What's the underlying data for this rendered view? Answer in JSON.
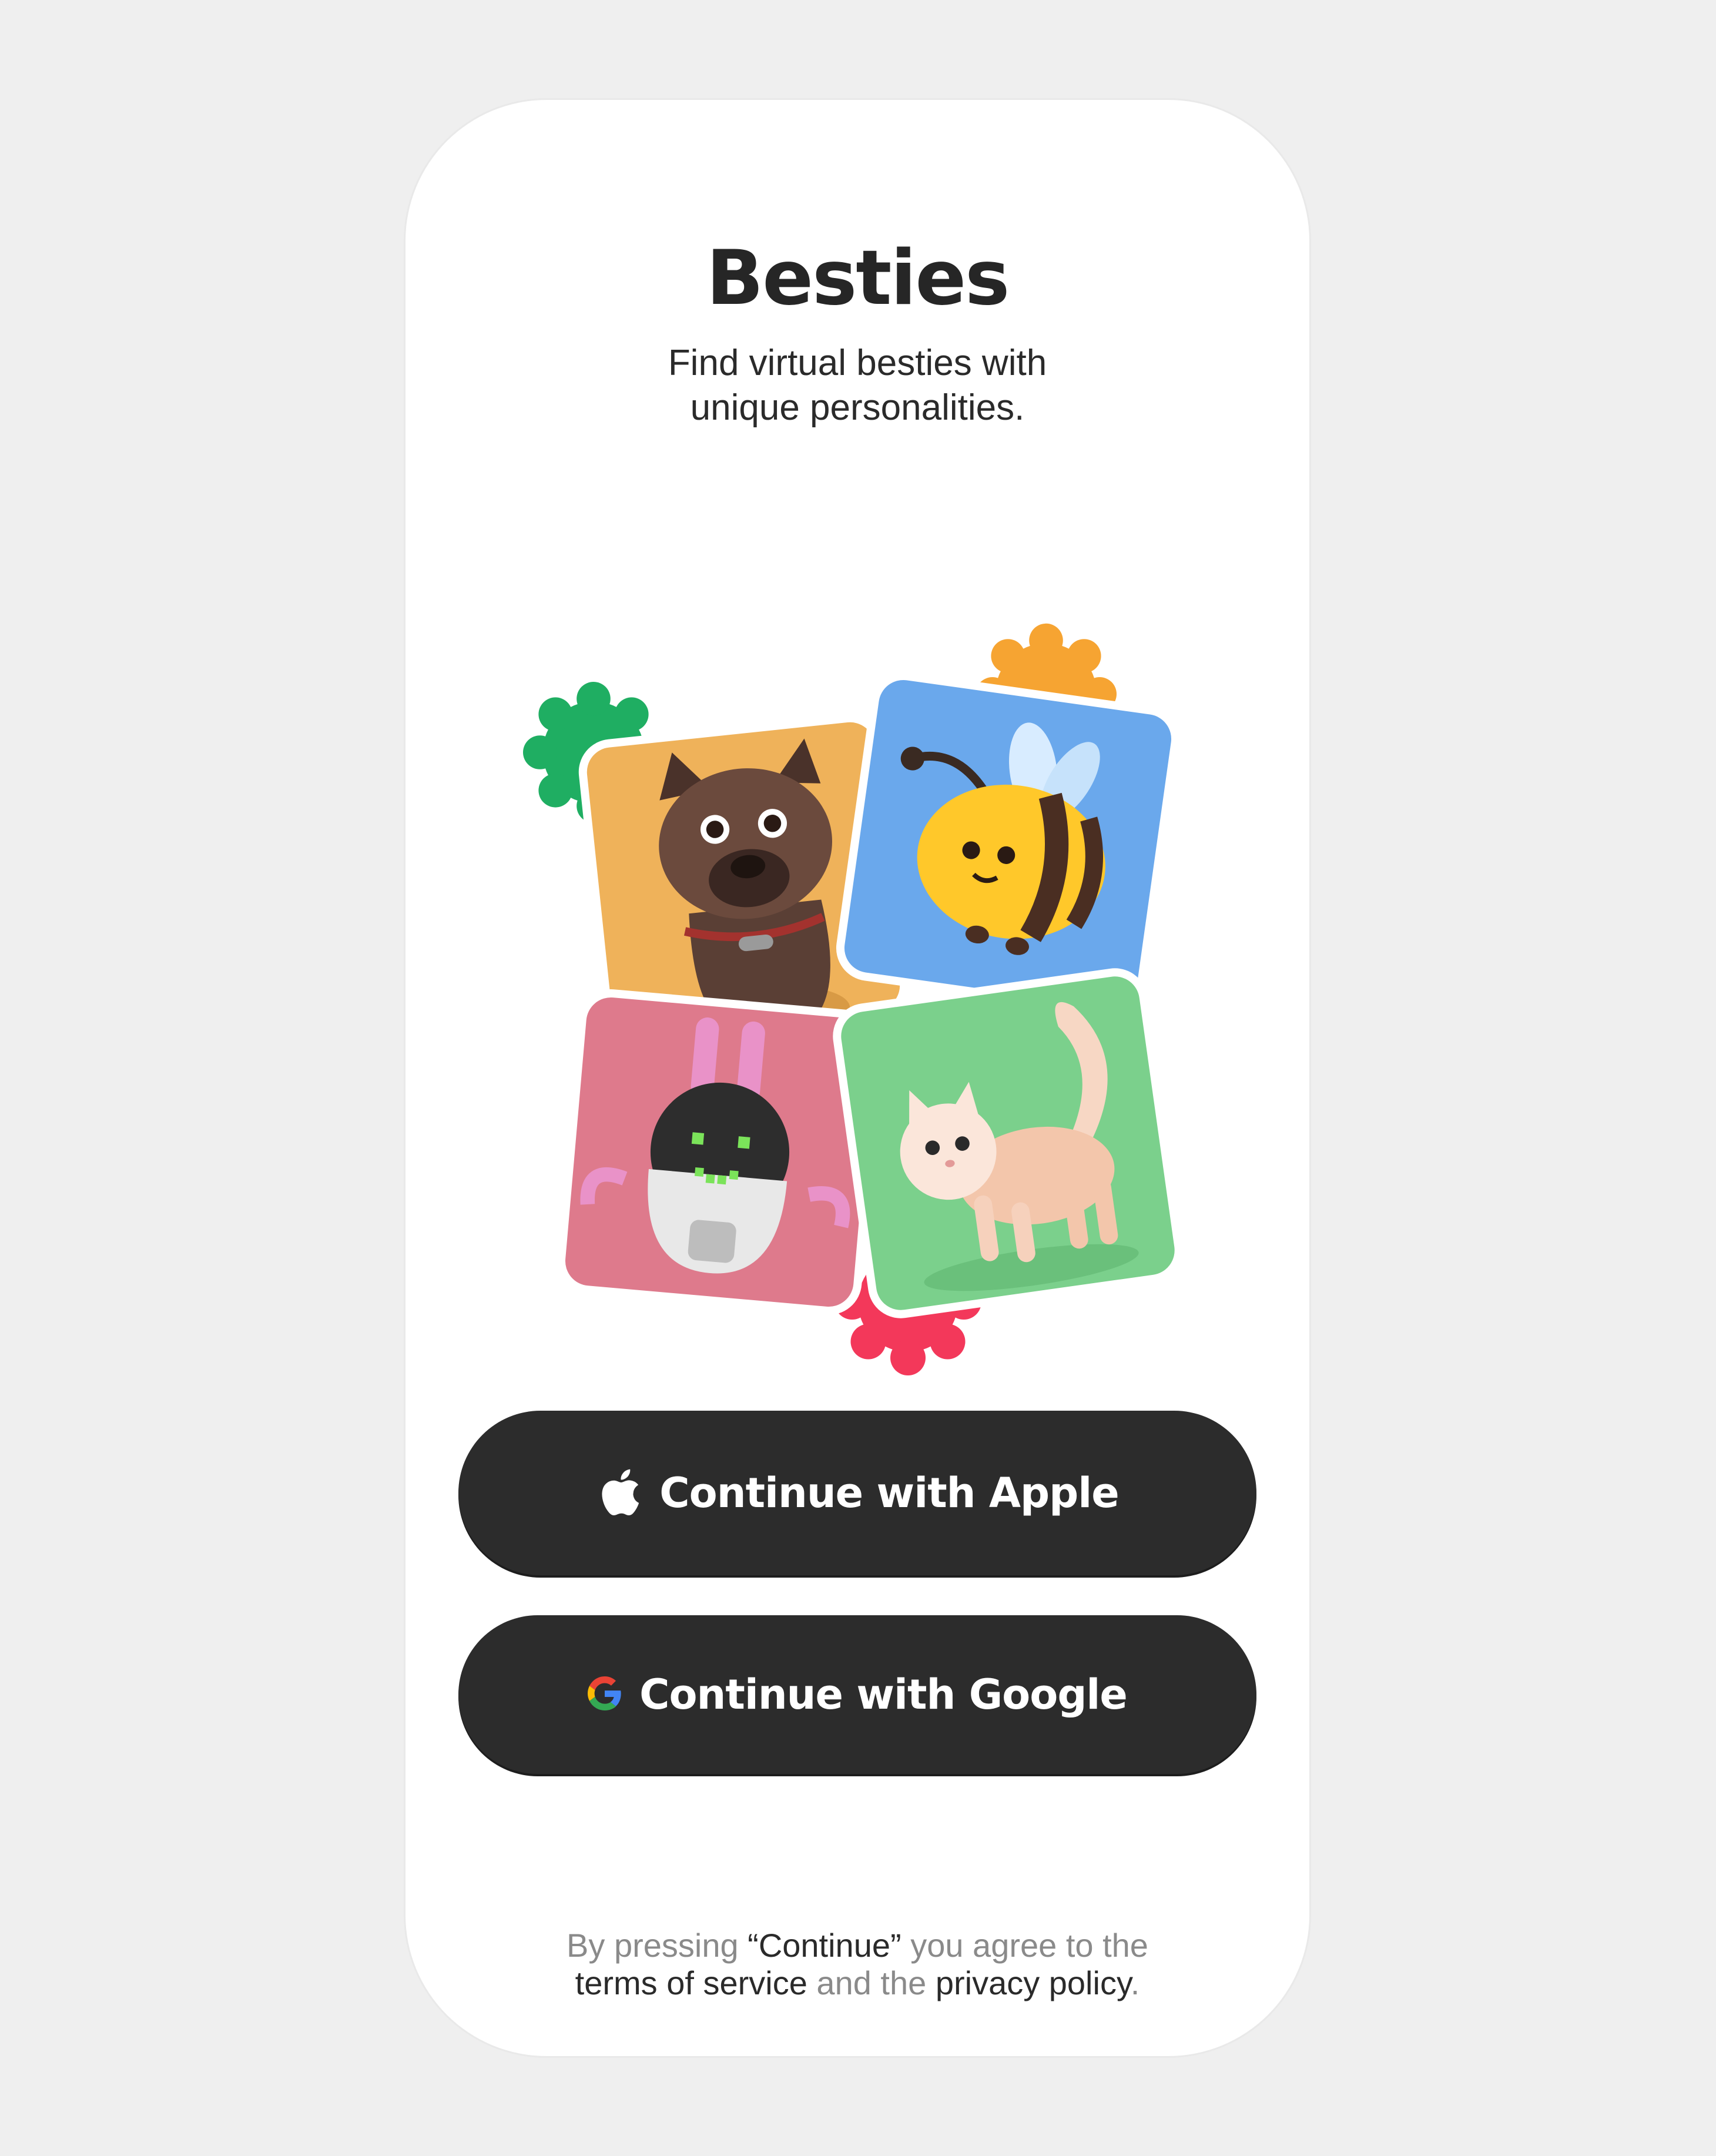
{
  "app": {
    "title": "Besties",
    "subtitle_line1": "Find virtual besties with",
    "subtitle_line2": "unique personalities."
  },
  "collage": {
    "tiles": [
      {
        "name": "dog",
        "bg": "#efb25a"
      },
      {
        "name": "bee",
        "bg": "#6aa8ec"
      },
      {
        "name": "robot-bunny",
        "bg": "#de7a8c"
      },
      {
        "name": "cat",
        "bg": "#7bd08c"
      }
    ],
    "blobs": [
      {
        "color": "#1fae62"
      },
      {
        "color": "#f6a432"
      },
      {
        "color": "#f3385a"
      }
    ]
  },
  "buttons": {
    "apple_label": "Continue with Apple",
    "apple_icon": "apple-icon",
    "google_label": "Continue with Google",
    "google_icon": "google-icon"
  },
  "legal": {
    "prefix": "By pressing ",
    "continue_word": "“Continue”",
    "middle": " you agree to the",
    "terms": "terms of service",
    "and": " and the ",
    "privacy": "privacy policy",
    "period": "."
  },
  "colors": {
    "background": "#efefef",
    "card": "#ffffff",
    "button": "#2c2c2c",
    "text": "#262626",
    "muted": "#8a8a8a"
  }
}
